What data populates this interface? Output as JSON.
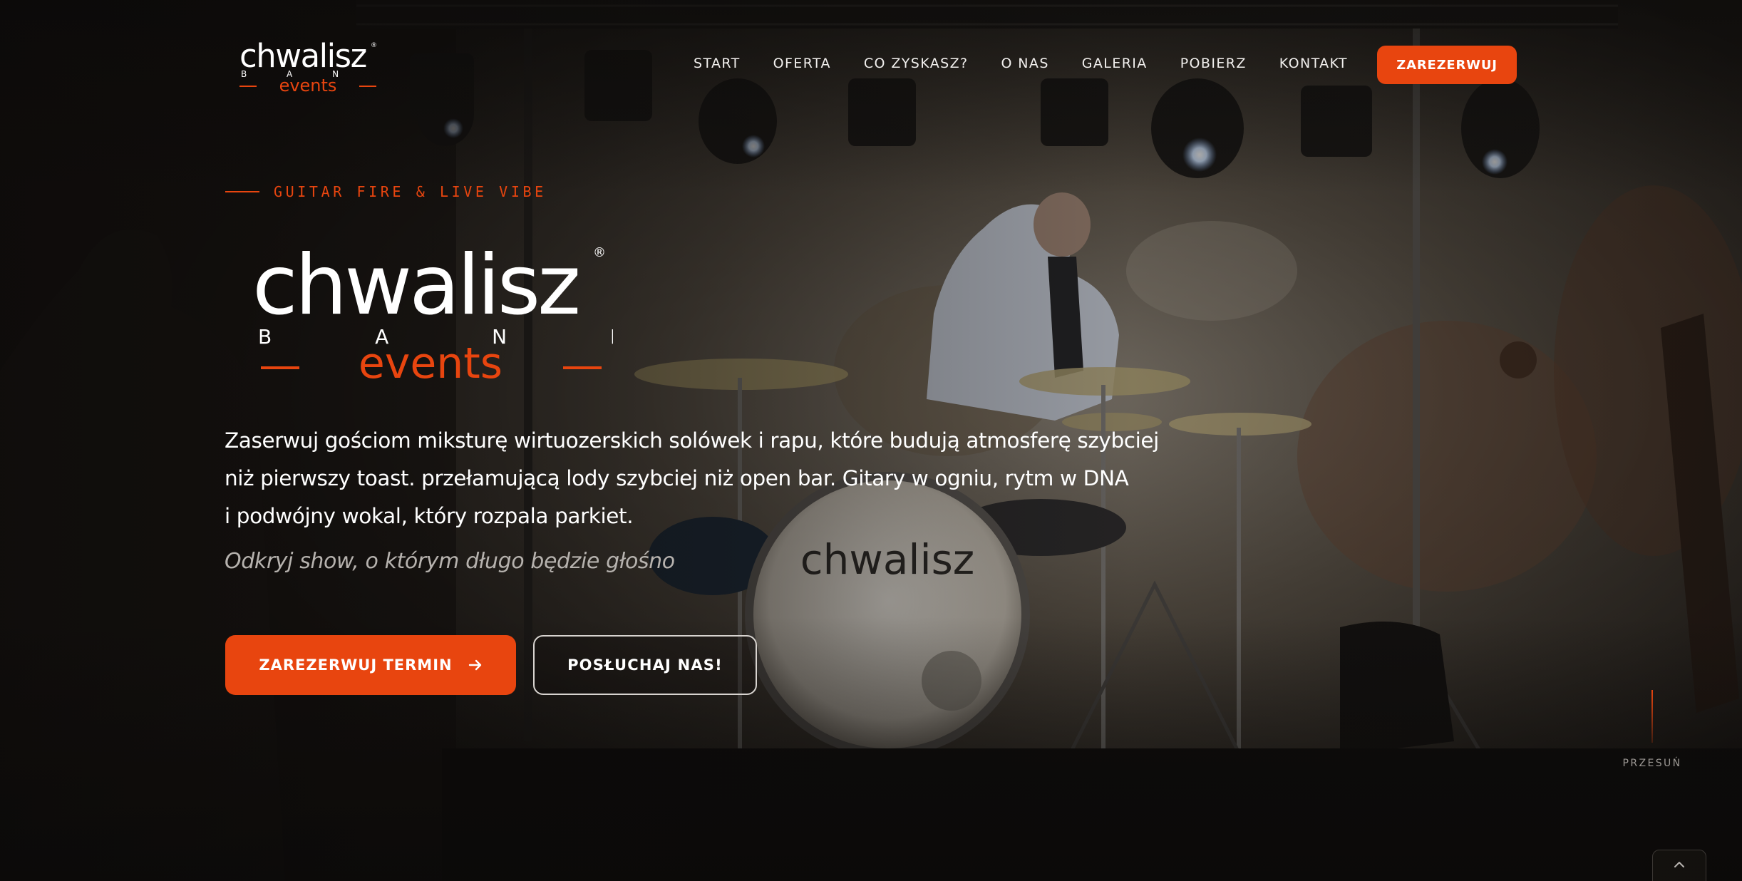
{
  "brand": {
    "name": "chwalisz",
    "sub": "B A N D",
    "events": "events",
    "registered": "®",
    "accent": "#e8450f"
  },
  "nav": {
    "items": [
      "START",
      "OFERTA",
      "CO ZYSKASZ?",
      "O NAS",
      "GALERIA",
      "POBIERZ",
      "KONTAKT"
    ],
    "cta": "ZAREZERWUJ"
  },
  "hero": {
    "eyebrow": "GUITAR FIRE & LIVE VIBE",
    "lead": [
      "Zaserwuj gościom miksturę wirtuozerskich solówek i rapu, które budują atmosferę szybciej",
      "niż pierwszy toast. przełamującą lody szybciej niż open bar. Gitary w ogniu, rytm w DNA",
      "i podwójny wokal, który rozpala parkiet."
    ],
    "tagline": "Odkryj show, o którym długo będzie głośno",
    "primary_button": "ZAREZERWUJ TERMIN",
    "primary_icon": "arrow-right-icon",
    "secondary_button": "POSŁUCHAJ NAS!",
    "drum_text": "chwalisz"
  },
  "scroll": {
    "label": "PRZESUŃ"
  },
  "back_to_top": {
    "icon": "chevron-up-icon"
  }
}
